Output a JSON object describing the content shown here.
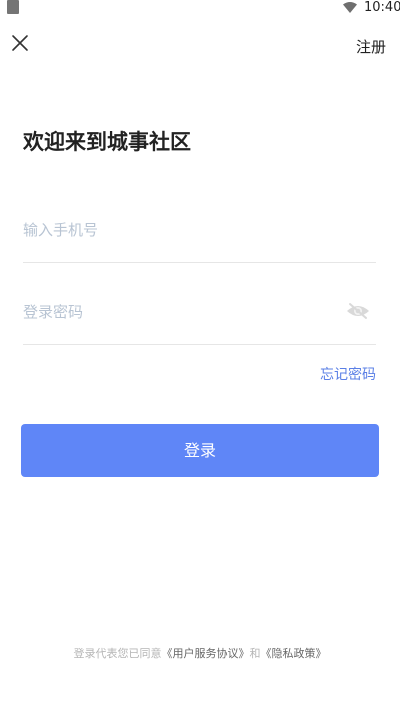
{
  "status_bar": {
    "time": "10:40"
  },
  "header": {
    "register_label": "注册"
  },
  "title": "欢迎来到城事社区",
  "form": {
    "phone_placeholder": "输入手机号",
    "password_placeholder": "登录密码",
    "forgot_label": "忘记密码",
    "login_label": "登录"
  },
  "agreement": {
    "prefix": "登录代表您已同意",
    "terms_link": "《用户服务协议》",
    "conjunction": "和",
    "privacy_link": "《隐私政策》"
  },
  "colors": {
    "accent": "#5f86f7",
    "link": "#5a7fe6",
    "placeholder": "#b8c4d3"
  }
}
